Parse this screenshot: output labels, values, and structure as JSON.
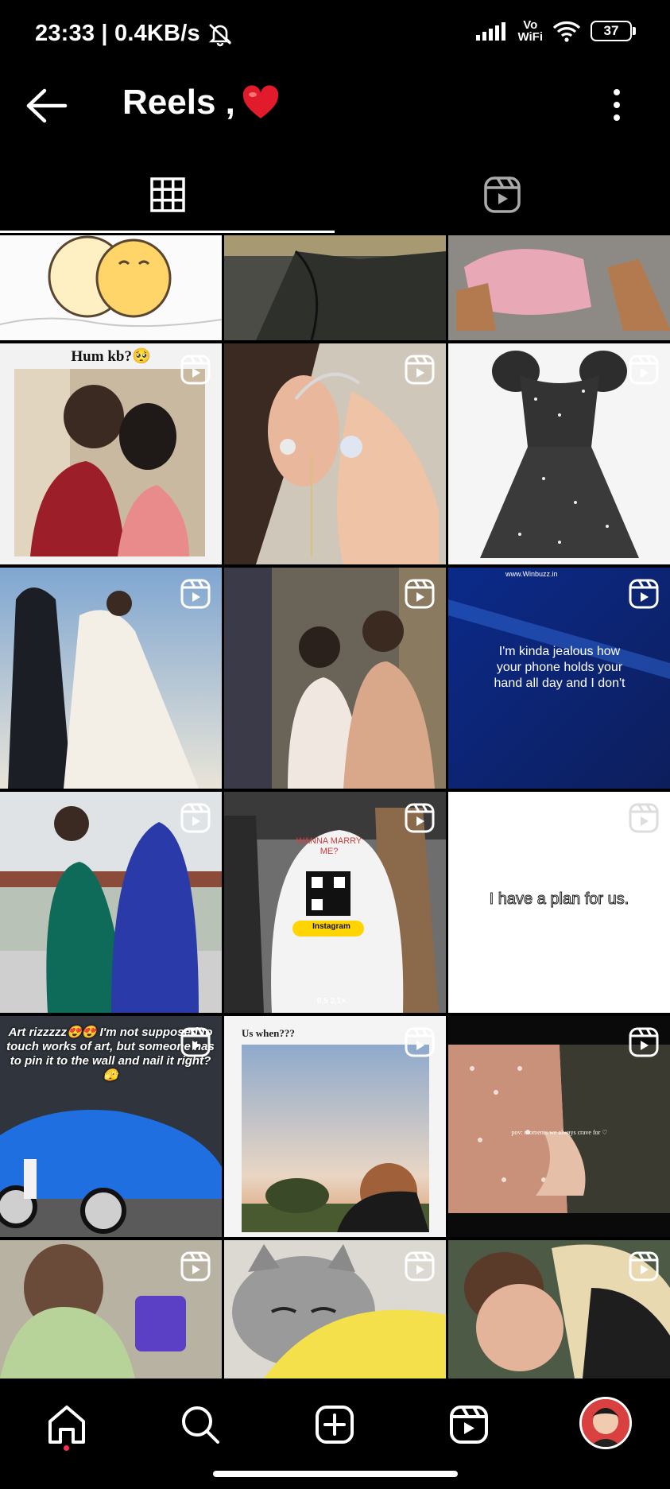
{
  "status": {
    "time_speed": "23:33 | 0.4KB/s",
    "volte_top": "Vo",
    "volte_bottom": "WiFi",
    "battery": "37"
  },
  "header": {
    "title": "Reels ,",
    "heart": "❤️"
  },
  "tabs": [
    {
      "label": "grid-view",
      "active": true
    },
    {
      "label": "reels-view",
      "active": false
    }
  ],
  "tiles": [
    {
      "caption": ""
    },
    {
      "caption": ""
    },
    {
      "caption": ""
    },
    {
      "caption": "Hum kb?🥺"
    },
    {
      "caption": ""
    },
    {
      "caption": ""
    },
    {
      "caption": ""
    },
    {
      "caption": ""
    },
    {
      "caption": "I'm kinda jealous how your phone holds your hand all day and I don't",
      "watermark": "www.Winbuzz.in"
    },
    {
      "caption": ""
    },
    {
      "caption": "WANNA MARRY ME?",
      "sub": "Instagram",
      "zoom": "0,5  2,1×"
    },
    {
      "caption": "I have a plan for us."
    },
    {
      "caption": "Art rizzzzz😍😍 I'm not supposed to touch works of art, but someone has to pin it to the wall and nail it right?🫣"
    },
    {
      "caption": "Us when???"
    },
    {
      "caption": "pov: moments we always crave for ♡"
    },
    {
      "caption": ""
    },
    {
      "caption": ""
    },
    {
      "caption": ""
    }
  ],
  "nav": {
    "home": "home",
    "search": "search",
    "create": "create",
    "reels": "reels",
    "profile": "profile"
  },
  "colors": {
    "background": "#000000",
    "accent_dot": "#ff2d55"
  }
}
